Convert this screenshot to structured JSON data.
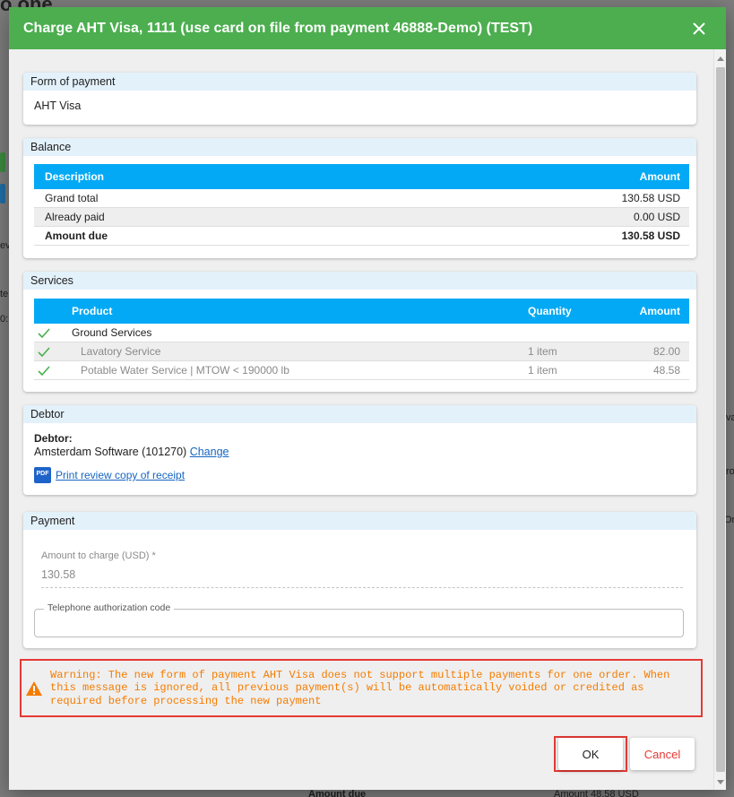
{
  "dialog": {
    "title": "Charge AHT Visa, 1111 (use card on file from payment 46888-Demo) (TEST)",
    "header_color": "#4cae4f"
  },
  "form_of_payment": {
    "heading": "Form of payment",
    "value": "AHT Visa"
  },
  "balance": {
    "heading": "Balance",
    "columns": [
      "Description",
      "Amount"
    ],
    "rows": [
      {
        "description": "Grand total",
        "amount": "130.58 USD"
      },
      {
        "description": "Already paid",
        "amount": "0.00 USD"
      },
      {
        "description": "Amount due",
        "amount": "130.58 USD"
      }
    ]
  },
  "services": {
    "heading": "Services",
    "columns": [
      "Product",
      "Quantity",
      "Amount"
    ],
    "rows": [
      {
        "product": "Ground Services",
        "quantity": "",
        "amount": ""
      },
      {
        "product": "Lavatory Service",
        "quantity": "1 item",
        "amount": "82.00"
      },
      {
        "product": "Potable Water Service | MTOW < 190000 lb",
        "quantity": "1 item",
        "amount": "48.58"
      }
    ]
  },
  "debtor": {
    "heading": "Debtor",
    "label": "Debtor:",
    "name": "Amsterdam Software (101270)",
    "change_link": "Change",
    "print_link": "Print review copy of receipt",
    "pdf_badge": "PDF"
  },
  "payment": {
    "heading": "Payment",
    "amount_label": "Amount to charge (USD) *",
    "amount_value": "130.58",
    "phone_label": "Telephone authorization code",
    "phone_value": ""
  },
  "warning": {
    "text": "Warning: The new form of payment AHT Visa does not support multiple payments for one order. When this message is ignored, all previous payment(s) will be automatically voided or credited as required before processing the new payment",
    "color": "#f57c00"
  },
  "buttons": {
    "ok": "OK",
    "cancel": "Cancel"
  },
  "background": {
    "logo": "o one",
    "snippets": [
      "ev",
      "te",
      "0:",
      "va",
      "ro",
      "Ord",
      "Amount due",
      "Amount 48.58 USD"
    ]
  }
}
